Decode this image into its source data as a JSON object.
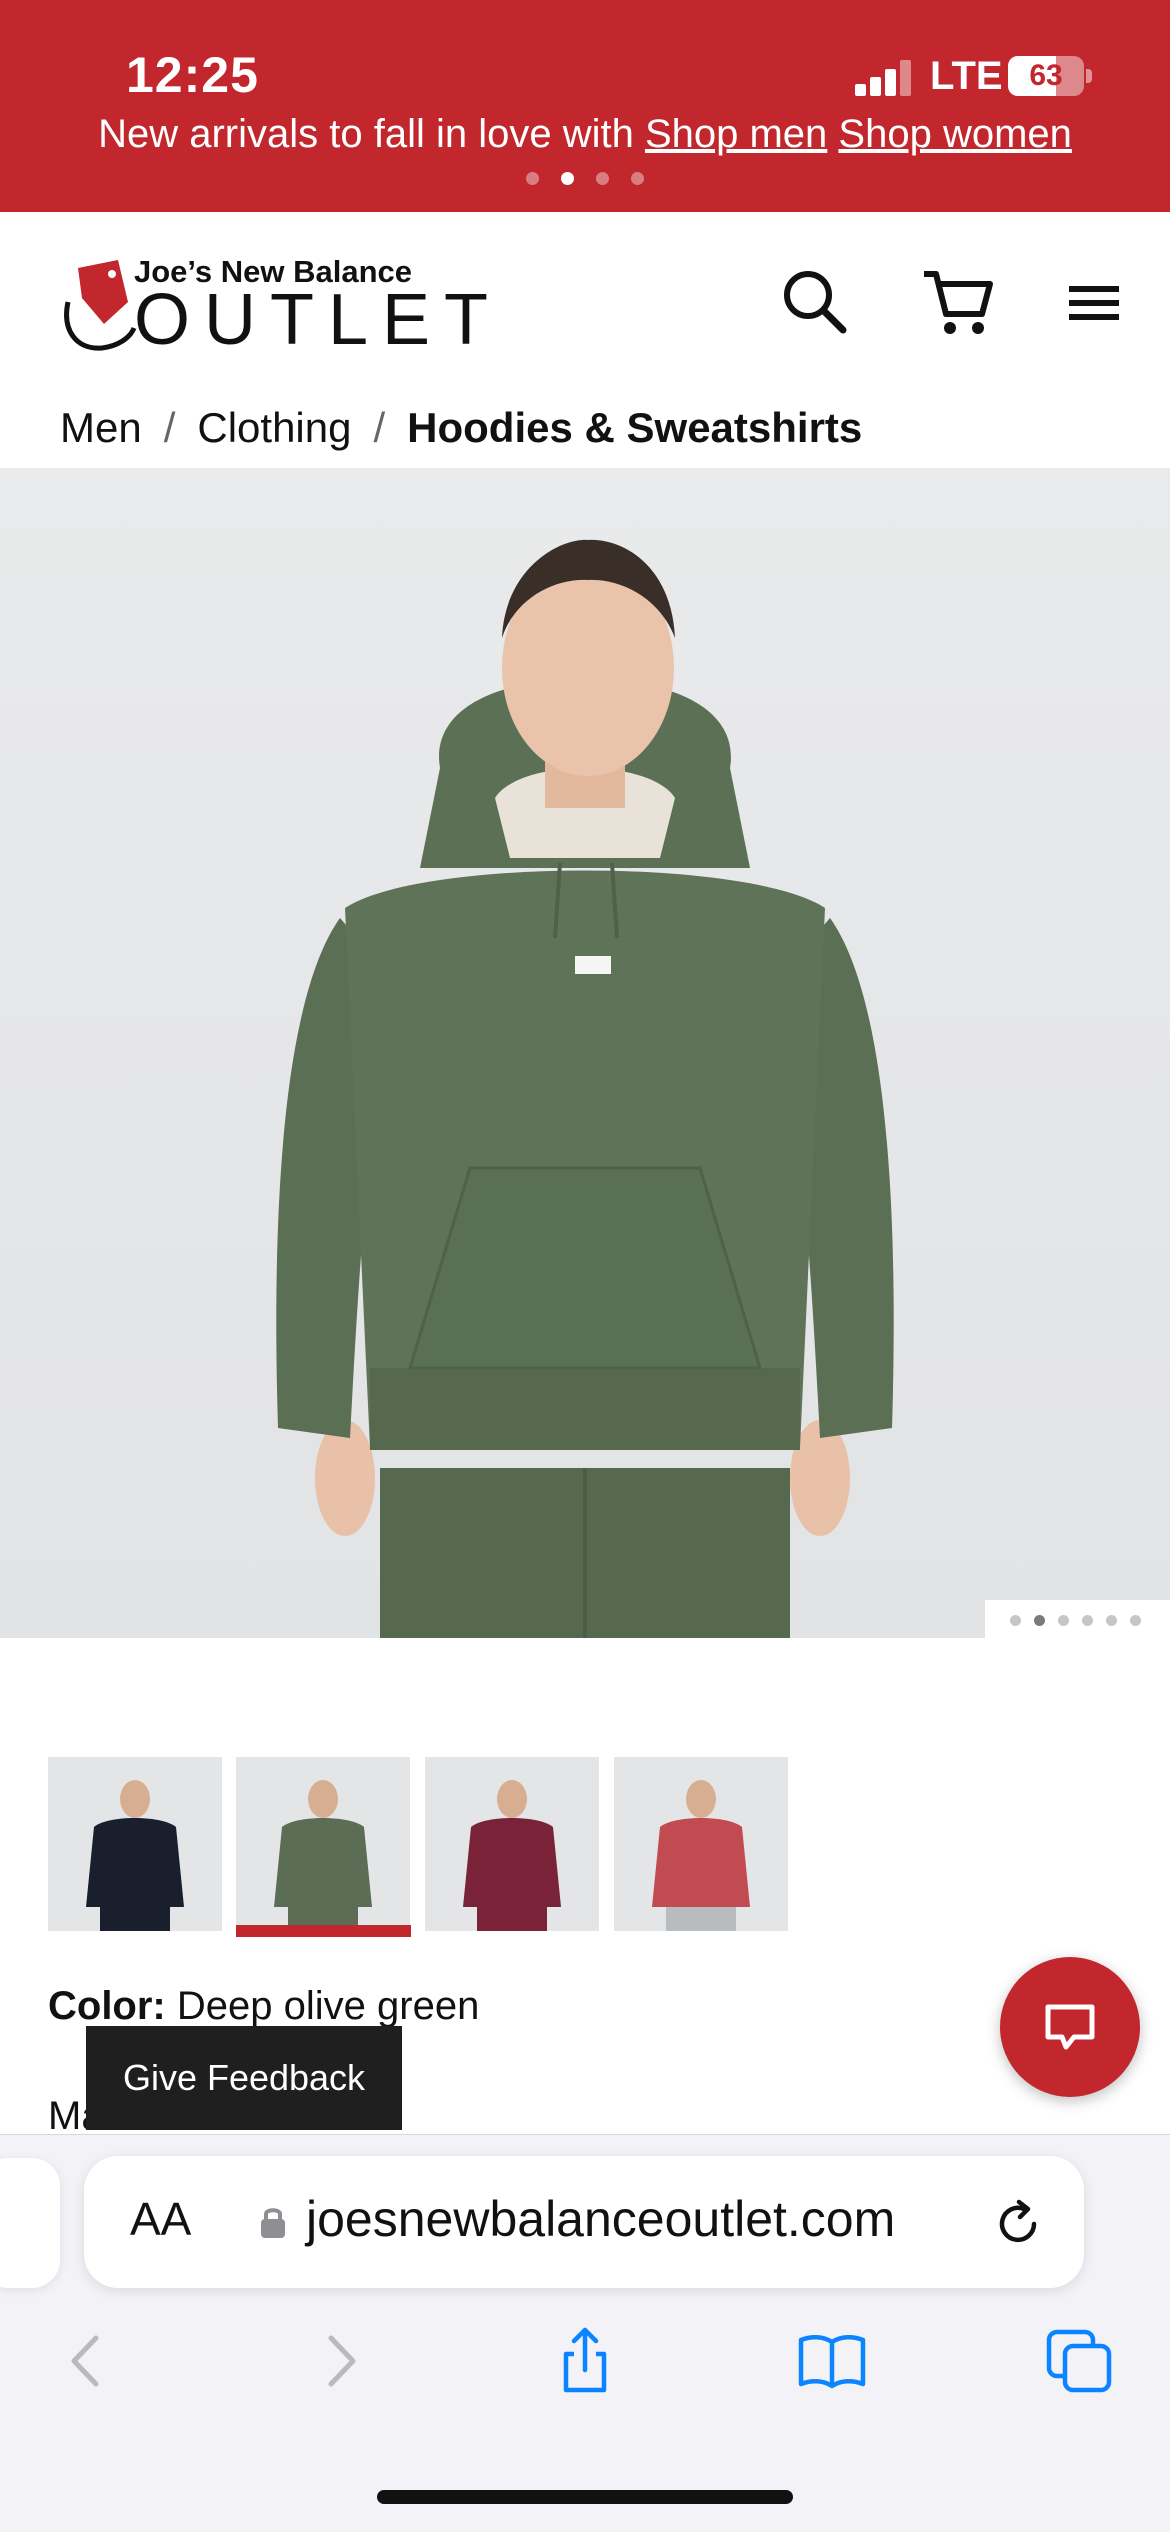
{
  "status_bar": {
    "time": "12:25",
    "network": "LTE",
    "battery": "63",
    "battery_level": 0.63
  },
  "promo": {
    "text": "New arrivals to fall in love with",
    "links": [
      "Shop men",
      "Shop women"
    ],
    "slide_count": 4,
    "active_slide": 2
  },
  "header": {
    "logo_top": "Joe’s New Balance",
    "logo_main": "OUTLET",
    "icons": [
      "search-icon",
      "cart-icon",
      "menu-icon"
    ]
  },
  "breadcrumb": [
    "Men",
    "Clothing",
    "Hoodies & Sweatshirts"
  ],
  "product": {
    "image_count": 6,
    "active_image": 2,
    "thumbnails": [
      {
        "name": "black",
        "color": "#1a1f2e"
      },
      {
        "name": "deep olive green",
        "color": "#5b6e55"
      },
      {
        "name": "burgundy",
        "color": "#7a2238"
      },
      {
        "name": "red",
        "color": "#c24b52"
      }
    ],
    "selected_thumbnail": 2,
    "color_label": "Color:",
    "color_value": "Deep olive green",
    "partial_text": "Ma..."
  },
  "feedback_label": "Give Feedback",
  "browser": {
    "aa_label": "AA",
    "url": "joesnewbalanceoutlet.com"
  },
  "colors": {
    "brand_red": "#c1272d",
    "safari_blue": "#0a84ff",
    "hoodie_green": "#5e7358"
  }
}
